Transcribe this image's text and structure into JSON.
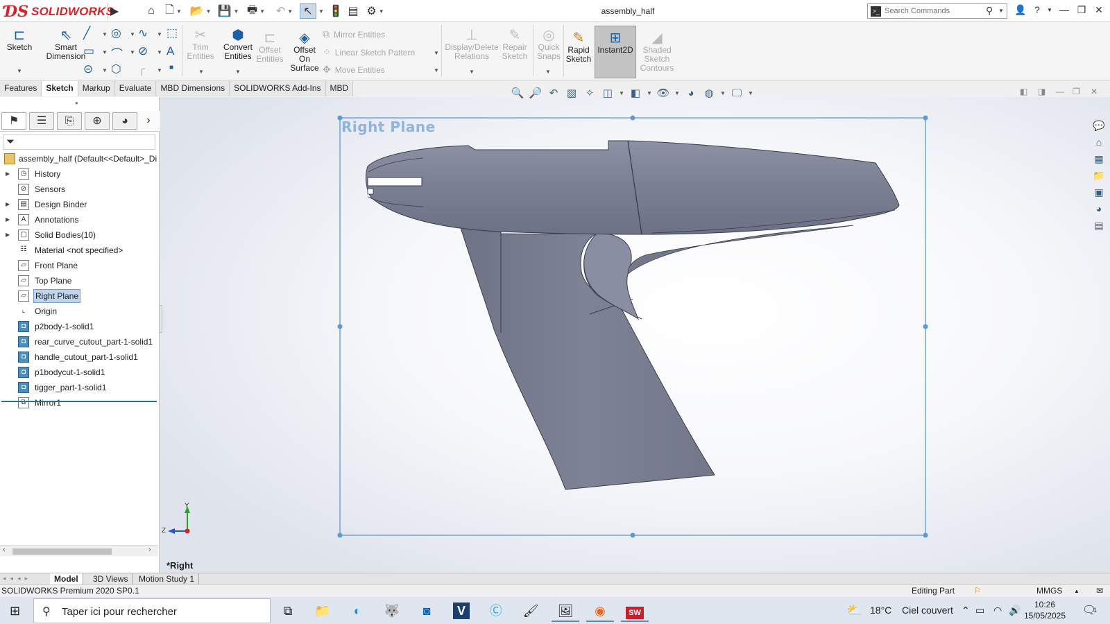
{
  "app": {
    "brand": "SOLIDWORKS",
    "document_title": "assembly_half"
  },
  "search": {
    "placeholder": "Search Commands"
  },
  "ribbon": {
    "sketch": "Sketch",
    "smart_dimension": [
      "Smart",
      "Dimension"
    ],
    "trim_entities": [
      "Trim",
      "Entities"
    ],
    "convert_entities": [
      "Convert",
      "Entities"
    ],
    "offset_entities": [
      "Offset",
      "Entities"
    ],
    "offset_on_surface": [
      "Offset",
      "On",
      "Surface"
    ],
    "mirror_entities": "Mirror Entities",
    "linear_sketch_pattern": "Linear Sketch Pattern",
    "move_entities": "Move Entities",
    "display_delete_relations": [
      "Display/Delete",
      "Relations"
    ],
    "repair_sketch": [
      "Repair",
      "Sketch"
    ],
    "quick_snaps": [
      "Quick",
      "Snaps"
    ],
    "rapid_sketch": [
      "Rapid",
      "Sketch"
    ],
    "instant2d": "Instant2D",
    "shaded_sketch_contours": [
      "Shaded",
      "Sketch",
      "Contours"
    ]
  },
  "tabs": [
    "Features",
    "Sketch",
    "Markup",
    "Evaluate",
    "MBD Dimensions",
    "SOLIDWORKS Add-Ins",
    "MBD"
  ],
  "active_tab": "Sketch",
  "tree": {
    "root": "assembly_half  (Default<<Default>_Di",
    "items": [
      {
        "label": "History",
        "icon": "history-icon",
        "expandable": true
      },
      {
        "label": "Sensors",
        "icon": "sensors-icon",
        "expandable": false
      },
      {
        "label": "Design Binder",
        "icon": "design-binder-icon",
        "expandable": true
      },
      {
        "label": "Annotations",
        "icon": "annotations-icon",
        "expandable": true
      },
      {
        "label": "Solid Bodies(10)",
        "icon": "solid-bodies-icon",
        "expandable": true
      },
      {
        "label": "Material <not specified>",
        "icon": "material-icon",
        "expandable": false
      },
      {
        "label": "Front Plane",
        "icon": "plane-icon",
        "expandable": false
      },
      {
        "label": "Top Plane",
        "icon": "plane-icon",
        "expandable": false
      },
      {
        "label": "Right Plane",
        "icon": "plane-icon",
        "expandable": false,
        "selected": true
      },
      {
        "label": "Origin",
        "icon": "origin-icon",
        "expandable": false
      },
      {
        "label": "p2body-1-solid1",
        "icon": "body-icon",
        "expandable": false
      },
      {
        "label": "rear_curve_cutout_part-1-solid1",
        "icon": "body-icon",
        "expandable": false
      },
      {
        "label": "handle_cutout_part-1-solid1",
        "icon": "body-icon",
        "expandable": false
      },
      {
        "label": "p1bodycut-1-solid1",
        "icon": "body-icon",
        "expandable": false
      },
      {
        "label": "tigger_part-1-solid1",
        "icon": "body-icon",
        "expandable": false
      },
      {
        "label": "Mirror1",
        "icon": "mirror-icon",
        "expandable": false
      }
    ]
  },
  "viewport": {
    "plane_label": "Right Plane",
    "view_name": "*Right",
    "triad": {
      "y": "Y",
      "z": "Z"
    },
    "model_color": "#7d8194"
  },
  "bottom_tabs": [
    "Model",
    "3D Views",
    "Motion Study 1"
  ],
  "status": {
    "product": "SOLIDWORKS Premium 2020 SP0.1",
    "mode": "Editing Part",
    "units": "MMGS"
  },
  "taskbar": {
    "search_placeholder": "Taper ici pour rechercher",
    "weather_temp": "18°C",
    "weather_text": "Ciel couvert",
    "time": "10:26",
    "date": "15/05/2025",
    "notifications": "1"
  },
  "colors": {
    "brand": "#d8232a",
    "selection": "#bfd5ee",
    "plane_border": "#5b9bd5"
  }
}
